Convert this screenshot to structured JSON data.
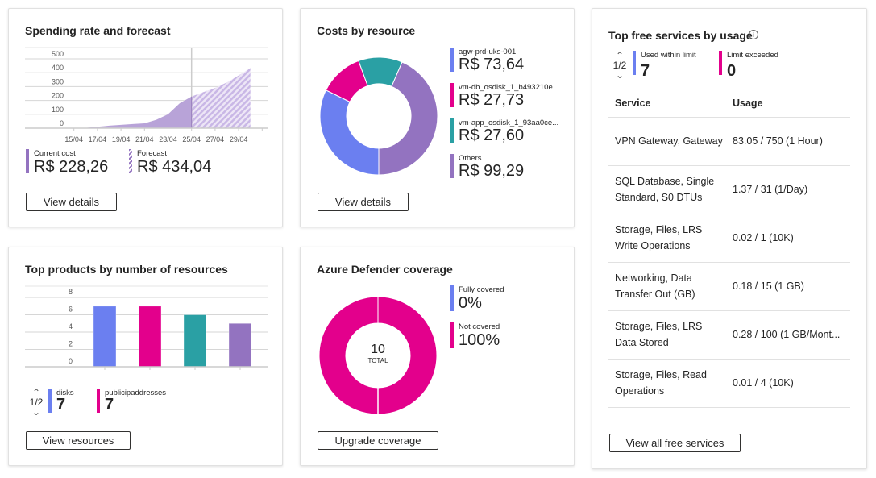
{
  "spending": {
    "title": "Spending rate and forecast",
    "chart_data": {
      "type": "area",
      "yticks": [
        "0",
        "100",
        "200",
        "300",
        "400",
        "500"
      ],
      "xticks": [
        "15/04",
        "17/04",
        "19/04",
        "21/04",
        "23/04",
        "25/04",
        "27/04",
        "29/04"
      ],
      "ylim": [
        0,
        580
      ],
      "actual": {
        "x": [
          "14/04",
          "15/04",
          "16/04",
          "17/04",
          "18/04",
          "19/04",
          "20/04",
          "21/04",
          "22/04",
          "23/04",
          "24/04",
          "25/04"
        ],
        "y": [
          0,
          0,
          2,
          10,
          18,
          24,
          30,
          35,
          60,
          100,
          180,
          228.26
        ]
      },
      "forecast": {
        "x": [
          "25/04",
          "26/04",
          "27/04",
          "28/04",
          "29/04",
          "30/04"
        ],
        "y": [
          228.26,
          260,
          290,
          330,
          380,
          434.04
        ]
      },
      "colors": {
        "actual": "#b8a3d8",
        "forecast": "#c9b7e6"
      }
    },
    "current_label": "Current cost",
    "current_value": "R$ 228,26",
    "forecast_label": "Forecast",
    "forecast_value": "R$ 434,04",
    "button": "View details"
  },
  "costs": {
    "title": "Costs by resource",
    "button": "View details",
    "chart_data": {
      "type": "pie",
      "values": [
        73.64,
        27.73,
        27.6,
        99.29
      ],
      "colors": [
        "#6b7ff0",
        "#e3008c",
        "#2aa0a4",
        "#9373c0"
      ]
    },
    "legend": [
      {
        "name": "agw-prd-uks-001",
        "value": "R$ 73,64",
        "color": "#6b7ff0"
      },
      {
        "name": "vm-db_osdisk_1_b493210e...",
        "value": "R$ 27,73",
        "color": "#e3008c"
      },
      {
        "name": "vm-app_osdisk_1_93aa0ce...",
        "value": "R$ 27,60",
        "color": "#2aa0a4"
      },
      {
        "name": "Others",
        "value": "R$ 99,29",
        "color": "#9373c0"
      }
    ]
  },
  "products": {
    "title": "Top products by number of resources",
    "button": "View resources",
    "pager": "1/2",
    "chart_data": {
      "type": "bar",
      "yticks": [
        "0",
        "2",
        "4",
        "6",
        "8"
      ],
      "ylim": [
        0,
        8
      ],
      "values": [
        7,
        7,
        6,
        5
      ],
      "colors": [
        "#6b7ff0",
        "#e3008c",
        "#2aa0a4",
        "#9373c0"
      ]
    },
    "legend": [
      {
        "name": "disks",
        "value": "7",
        "color": "#6b7ff0"
      },
      {
        "name": "publicipaddresses",
        "value": "7",
        "color": "#e3008c"
      }
    ]
  },
  "defender": {
    "title": "Azure Defender coverage",
    "button": "Upgrade coverage",
    "total": "10",
    "total_label": "TOTAL",
    "chart_data": {
      "type": "pie",
      "values": [
        0,
        100
      ],
      "colors": [
        "#6b7ff0",
        "#e3008c"
      ]
    },
    "legend": [
      {
        "name": "Fully covered",
        "value": "0%",
        "color": "#6b7ff0"
      },
      {
        "name": "Not covered",
        "value": "100%",
        "color": "#e3008c"
      }
    ]
  },
  "free": {
    "title": "Top free services by usage",
    "pager": "1/2",
    "button": "View all free services",
    "legend": [
      {
        "name": "Used within limit",
        "value": "7",
        "color": "#6b7ff0"
      },
      {
        "name": "Limit exceeded",
        "value": "0",
        "color": "#e3008c"
      }
    ],
    "columns": [
      "Service",
      "Usage"
    ],
    "rows": [
      [
        "VPN Gateway, Gateway",
        "83.05 / 750 (1 Hour)"
      ],
      [
        "SQL Database, Single Standard, S0 DTUs",
        "1.37 / 31 (1/Day)"
      ],
      [
        "Storage, Files, LRS Write Operations",
        "0.02 / 1 (10K)"
      ],
      [
        "Networking, Data Transfer Out (GB)",
        "0.18 / 15 (1 GB)"
      ],
      [
        "Storage, Files, LRS Data Stored",
        "0.28 / 100 (1 GB/Mont..."
      ],
      [
        "Storage, Files, Read Operations",
        "0.01 / 4 (10K)"
      ]
    ]
  }
}
